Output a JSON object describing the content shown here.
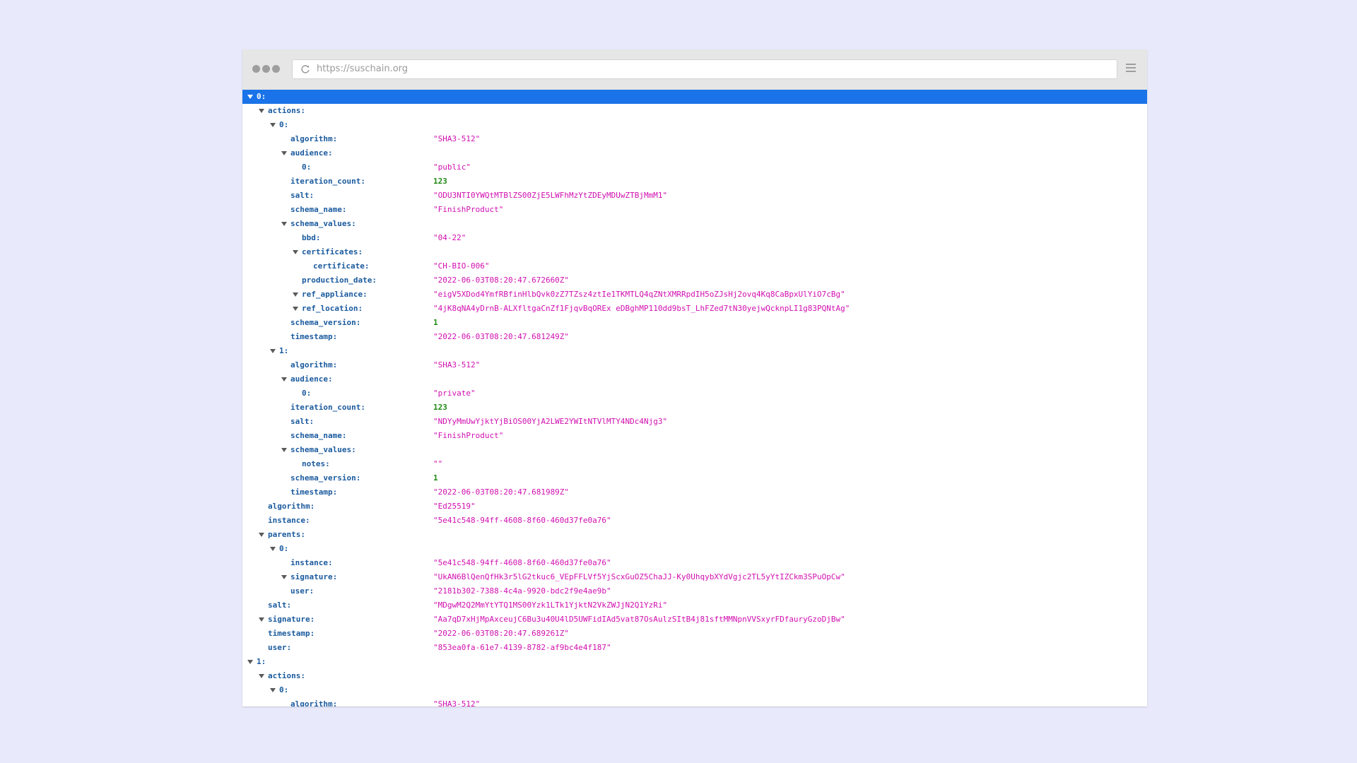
{
  "browser": {
    "url": "https://suschain.org"
  },
  "rows": [
    {
      "key": "0:",
      "depth": 0,
      "expanded": true,
      "selected": true
    },
    {
      "key": "actions:",
      "depth": 1,
      "expanded": true
    },
    {
      "key": "0:",
      "depth": 2,
      "expanded": true
    },
    {
      "key": "algorithm:",
      "depth": 3,
      "value": "\"SHA3-512\"",
      "type": "string"
    },
    {
      "key": "audience:",
      "depth": 3,
      "expanded": true
    },
    {
      "key": "0:",
      "depth": 4,
      "value": "\"public\"",
      "type": "string"
    },
    {
      "key": "iteration_count:",
      "depth": 3,
      "value": "123",
      "type": "number"
    },
    {
      "key": "salt:",
      "depth": 3,
      "value": "\"ODU3NTI0YWQtMTBlZS00ZjE5LWFhMzYtZDEyMDUwZTBjMmM1\"",
      "type": "string"
    },
    {
      "key": "schema_name:",
      "depth": 3,
      "value": "\"FinishProduct\"",
      "type": "string"
    },
    {
      "key": "schema_values:",
      "depth": 3,
      "expanded": true
    },
    {
      "key": "bbd:",
      "depth": 4,
      "value": "\"04-22\"",
      "type": "string"
    },
    {
      "key": "certificates:",
      "depth": 4,
      "expanded": true
    },
    {
      "key": "certificate:",
      "depth": 5,
      "value": "\"CH-BIO-006\"",
      "type": "string"
    },
    {
      "key": "production_date:",
      "depth": 4,
      "value": "\"2022-06-03T08:20:47.672660Z\"",
      "type": "string"
    },
    {
      "key": "ref_appliance:",
      "depth": 4,
      "expanded": true,
      "value": "\"eigV5XDod4YmfRBfinHlbQvk0zZ7TZsz4ztIe1TKMTLQ4qZNtXMRRpdIH5oZJsHj2ovq4Kq8CaBpxUlYiO7cBg\"",
      "type": "string"
    },
    {
      "key": "ref_location:",
      "depth": 4,
      "expanded": true,
      "value": "\"4jK8qNA4yDrnB-ALXfltgaCnZf1FjqvBqOREx eDBghMP110dd9bsT_LhFZed7tN30yejwQcknpLI1g83PQNtAg\"",
      "type": "string"
    },
    {
      "key": "schema_version:",
      "depth": 3,
      "value": "1",
      "type": "number"
    },
    {
      "key": "timestamp:",
      "depth": 3,
      "value": "\"2022-06-03T08:20:47.681249Z\"",
      "type": "string"
    },
    {
      "key": "1:",
      "depth": 2,
      "expanded": true
    },
    {
      "key": "algorithm:",
      "depth": 3,
      "value": "\"SHA3-512\"",
      "type": "string"
    },
    {
      "key": "audience:",
      "depth": 3,
      "expanded": true
    },
    {
      "key": "0:",
      "depth": 4,
      "value": "\"private\"",
      "type": "string"
    },
    {
      "key": "iteration_count:",
      "depth": 3,
      "value": "123",
      "type": "number"
    },
    {
      "key": "salt:",
      "depth": 3,
      "value": "\"NDYyMmUwYjktYjBiOS00YjA2LWE2YWItNTVlMTY4NDc4Njg3\"",
      "type": "string"
    },
    {
      "key": "schema_name:",
      "depth": 3,
      "value": "\"FinishProduct\"",
      "type": "string"
    },
    {
      "key": "schema_values:",
      "depth": 3,
      "expanded": true
    },
    {
      "key": "notes:",
      "depth": 4,
      "value": "\"\"",
      "type": "string"
    },
    {
      "key": "schema_version:",
      "depth": 3,
      "value": "1",
      "type": "number"
    },
    {
      "key": "timestamp:",
      "depth": 3,
      "value": "\"2022-06-03T08:20:47.681989Z\"",
      "type": "string"
    },
    {
      "key": "algorithm:",
      "depth": 1,
      "value": "\"Ed25519\"",
      "type": "string"
    },
    {
      "key": "instance:",
      "depth": 1,
      "value": "\"5e41c548-94ff-4608-8f60-460d37fe0a76\"",
      "type": "string"
    },
    {
      "key": "parents:",
      "depth": 1,
      "expanded": true
    },
    {
      "key": "0:",
      "depth": 2,
      "expanded": true
    },
    {
      "key": "instance:",
      "depth": 3,
      "value": "\"5e41c548-94ff-4608-8f60-460d37fe0a76\"",
      "type": "string"
    },
    {
      "key": "signature:",
      "depth": 3,
      "expanded": true,
      "value": "\"UkAN6BlQenQfHk3r5lG2tkuc6_VEpFFLVf5YjScxGuOZ5ChaJJ-Ky0UhqybXYdVgjc2TL5yYtIZCkm3SPuOpCw\"",
      "type": "string"
    },
    {
      "key": "user:",
      "depth": 3,
      "value": "\"2181b302-7388-4c4a-9920-bdc2f9e4ae9b\"",
      "type": "string"
    },
    {
      "key": "salt:",
      "depth": 1,
      "value": "\"MDgwM2Q2MmYtYTQ1MS00Yzk1LTk1YjktN2VkZWJjN2Q1YzRi\"",
      "type": "string"
    },
    {
      "key": "signature:",
      "depth": 1,
      "expanded": true,
      "value": "\"Aa7qD7xHjMpAxceujC6Bu3u40U4lD5UWFidIAd5vat87OsAulzSItB4j81sftMMNpnVVSxyrFDfauryGzoDjBw\"",
      "type": "string"
    },
    {
      "key": "timestamp:",
      "depth": 1,
      "value": "\"2022-06-03T08:20:47.689261Z\"",
      "type": "string"
    },
    {
      "key": "user:",
      "depth": 1,
      "value": "\"853ea0fa-61e7-4139-8782-af9bc4e4f187\"",
      "type": "string"
    },
    {
      "key": "1:",
      "depth": 0,
      "expanded": true
    },
    {
      "key": "actions:",
      "depth": 1,
      "expanded": true
    },
    {
      "key": "0:",
      "depth": 2,
      "expanded": true
    },
    {
      "key": "algorithm:",
      "depth": 3,
      "value": "\"SHA3-512\"",
      "type": "string"
    }
  ]
}
